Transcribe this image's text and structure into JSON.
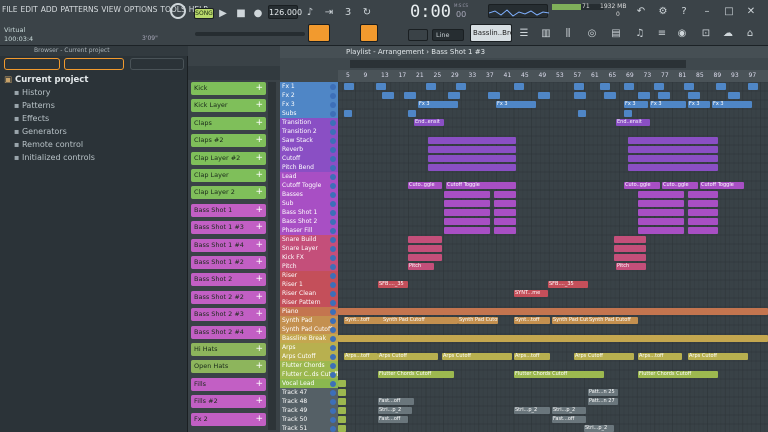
{
  "menu": [
    "FILE",
    "EDIT",
    "ADD",
    "PATTERNS",
    "VIEW",
    "OPTIONS",
    "TOOLS",
    "HELP"
  ],
  "transport": {
    "mode": "SONG",
    "tempo": "126.000",
    "time": "0:00",
    "time_sub": "00",
    "time_label": "M:S:CS",
    "cpu": "71",
    "mem": "1932 MB",
    "voices": "0"
  },
  "hint": {
    "line1": "Virtual",
    "line2": "100:03:4",
    "time": "3'09\""
  },
  "snap": "Line",
  "pattern_selector": "Basslin..Break",
  "browser": {
    "title": "Browser - Current project",
    "root": "Current project",
    "items": [
      "History",
      "Patterns",
      "Effects",
      "Generators",
      "Remote control",
      "Initialized controls"
    ]
  },
  "playlist": {
    "title": "Playlist - Arrangement › Bass Shot 1 #3",
    "ruler": [
      "5",
      "9",
      "13",
      "17",
      "21",
      "25",
      "29",
      "33",
      "37",
      "41",
      "45",
      "49",
      "53",
      "57",
      "61",
      "65",
      "69",
      "73",
      "77",
      "81",
      "85",
      "89",
      "93",
      "97"
    ]
  },
  "channels": [
    {
      "name": "Kick",
      "color": "#7fbf5a"
    },
    {
      "name": "Kick Layer",
      "color": "#7fbf5a"
    },
    {
      "name": "Claps",
      "color": "#7fbf5a"
    },
    {
      "name": "Claps #2",
      "color": "#7fbf5a"
    },
    {
      "name": "Clap Layer #2",
      "color": "#7fbf5a"
    },
    {
      "name": "Clap Layer",
      "color": "#7fbf5a"
    },
    {
      "name": "Clap Layer 2",
      "color": "#7fbf5a"
    },
    {
      "name": "Bass Shot 1",
      "color": "#c25fc4"
    },
    {
      "name": "Bass Shot 1 #3",
      "color": "#c25fc4"
    },
    {
      "name": "Bass Shot 1 #4",
      "color": "#c25fc4"
    },
    {
      "name": "Bass Shot 1 #2",
      "color": "#c25fc4"
    },
    {
      "name": "Bass Shot 2",
      "color": "#c25fc4"
    },
    {
      "name": "Bass Shot 2 #2",
      "color": "#c25fc4"
    },
    {
      "name": "Bass Shot 2 #3",
      "color": "#c25fc4"
    },
    {
      "name": "Bass Shot 2 #4",
      "color": "#c25fc4"
    },
    {
      "name": "Hi Hats",
      "color": "#8db55c"
    },
    {
      "name": "Open Hats",
      "color": "#8db55c"
    },
    {
      "name": "Fills",
      "color": "#c25fc4"
    },
    {
      "name": "Fills #2",
      "color": "#c25fc4"
    },
    {
      "name": "Fx 2",
      "color": "#c25fc4"
    }
  ],
  "tracks": [
    {
      "name": "Fx 1",
      "color": "#4f86c6"
    },
    {
      "name": "Fx 2",
      "color": "#4f86c6"
    },
    {
      "name": "Fx 3",
      "color": "#4f86c6"
    },
    {
      "name": "Subs",
      "color": "#4f86c6"
    },
    {
      "name": "Transition",
      "color": "#8a4fc4"
    },
    {
      "name": "Transition 2",
      "color": "#8a4fc4"
    },
    {
      "name": "Saw Stack",
      "color": "#8a4fc4"
    },
    {
      "name": "Reverb",
      "color": "#8a4fc4"
    },
    {
      "name": "Cutoff",
      "color": "#8a4fc4"
    },
    {
      "name": "Pitch Bend",
      "color": "#8a4fc4"
    },
    {
      "name": "Lead",
      "color": "#a84fc4"
    },
    {
      "name": "Cutoff Toggle",
      "color": "#a84fc4"
    },
    {
      "name": "Basses",
      "color": "#a84fc4"
    },
    {
      "name": "Sub",
      "color": "#a84fc4"
    },
    {
      "name": "Bass Shot 1",
      "color": "#a84fc4"
    },
    {
      "name": "Bass Shot 2",
      "color": "#a84fc4"
    },
    {
      "name": "Phaser Fill",
      "color": "#a84fc4"
    },
    {
      "name": "Snare Build",
      "color": "#c44f7a"
    },
    {
      "name": "Snare Layer",
      "color": "#c44f7a"
    },
    {
      "name": "Kick FX",
      "color": "#c44f7a"
    },
    {
      "name": "Pitch",
      "color": "#c44f7a"
    },
    {
      "name": "Riser",
      "color": "#c44f5a"
    },
    {
      "name": "Riser 1",
      "color": "#c44f5a"
    },
    {
      "name": "Riser Clean",
      "color": "#c44f5a"
    },
    {
      "name": "Riser Pattern",
      "color": "#c44f5a"
    },
    {
      "name": "Piano",
      "color": "#c4754f"
    },
    {
      "name": "Synth Pad",
      "color": "#c4904f"
    },
    {
      "name": "Synth Pad Cutoff",
      "color": "#c4904f"
    },
    {
      "name": "Bassline Break",
      "color": "#c4a74f"
    },
    {
      "name": "Arps",
      "color": "#b8b04f"
    },
    {
      "name": "Arps Cutoff",
      "color": "#b8b04f"
    },
    {
      "name": "Flutter Chords",
      "color": "#9cb84f"
    },
    {
      "name": "Flutter C..ds Cutoff",
      "color": "#9cb84f"
    },
    {
      "name": "Vocal Lead",
      "color": "#8ab84f"
    },
    {
      "name": "Track 47",
      "color": "#556066"
    },
    {
      "name": "Track 48",
      "color": "#556066"
    },
    {
      "name": "Track 49",
      "color": "#556066"
    },
    {
      "name": "Track 50",
      "color": "#556066"
    },
    {
      "name": "Track 51",
      "color": "#556066"
    }
  ],
  "clip_labels": {
    "fx3": "Fx 3",
    "end": "End..ensit",
    "cutoff_toggle": "Cuto..ggle",
    "cutoff_toggle2": "Cutoff Toggle",
    "pitch": "Pitch",
    "sfb": "SFB...._35",
    "synth_me": "SYNT...me",
    "synth_toff": "Synt...toff",
    "synth_pad_cutoff": "Synth Pad Cutoff",
    "arps_toff": "Arps...toff",
    "arps_cutoff": "Arps Cutoff",
    "flutter": "Flutter Chords Cutoff",
    "fast": "Fast...off",
    "stri": "Stri...p_2",
    "patt25": "Patt...n 25",
    "patt27": "Patt...n 27"
  },
  "colors": {
    "bg": "#2a3237",
    "grid": "#394247",
    "accent": "#f29a2e"
  }
}
